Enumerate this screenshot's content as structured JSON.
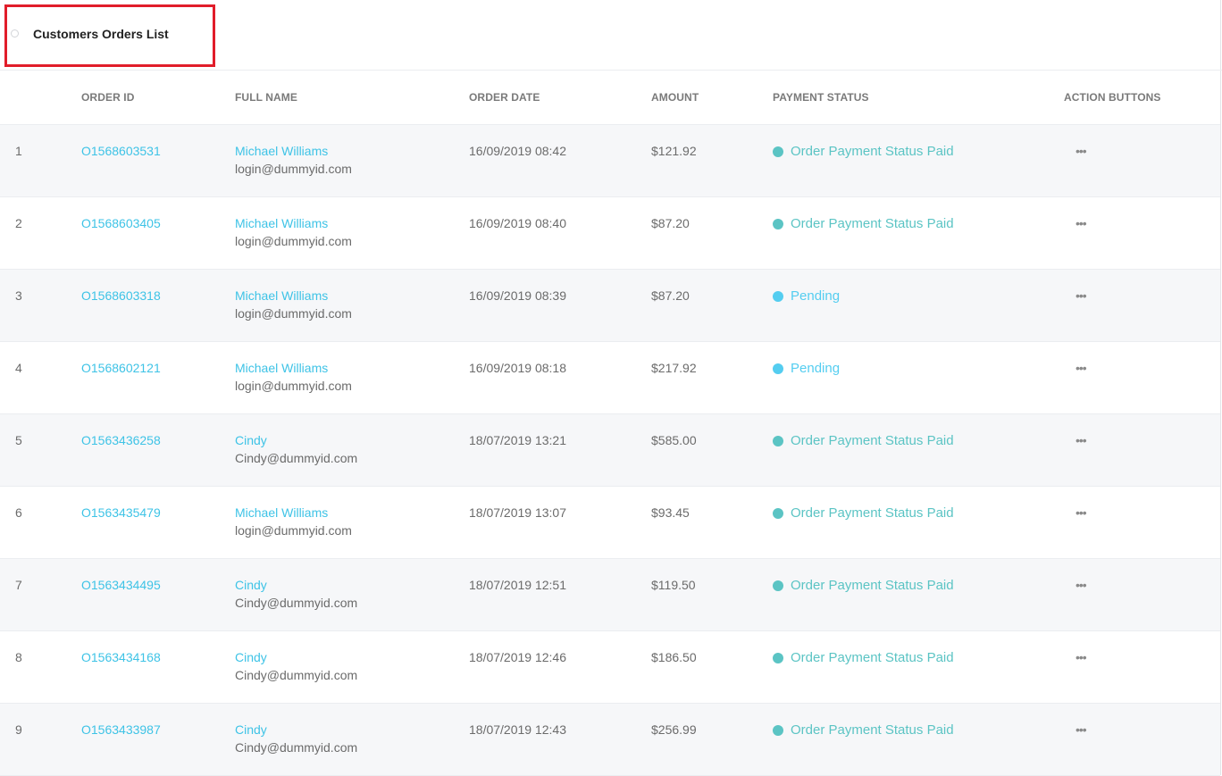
{
  "header": {
    "title": "Customers Orders List"
  },
  "colors": {
    "paid": "#5bc4c4",
    "pending": "#54cdf0",
    "link": "#3ec3e6",
    "highlight": "#e11d2a"
  },
  "table": {
    "columns": [
      "",
      "ORDER ID",
      "FULL NAME",
      "ORDER DATE",
      "AMOUNT",
      "PAYMENT STATUS",
      "ACTION BUTTONS"
    ],
    "rows": [
      {
        "num": "1",
        "order_id": "O1568603531",
        "name": "Michael Williams",
        "email": "login@dummyid.com",
        "date": "16/09/2019 08:42",
        "amount": "$121.92",
        "status": "Order Payment Status Paid",
        "status_type": "paid",
        "action_icon": "more-horizontal-icon"
      },
      {
        "num": "2",
        "order_id": "O1568603405",
        "name": "Michael Williams",
        "email": "login@dummyid.com",
        "date": "16/09/2019 08:40",
        "amount": "$87.20",
        "status": "Order Payment Status Paid",
        "status_type": "paid",
        "action_icon": "more-horizontal-icon"
      },
      {
        "num": "3",
        "order_id": "O1568603318",
        "name": "Michael Williams",
        "email": "login@dummyid.com",
        "date": "16/09/2019 08:39",
        "amount": "$87.20",
        "status": "Pending",
        "status_type": "pending",
        "action_icon": "more-horizontal-icon"
      },
      {
        "num": "4",
        "order_id": "O1568602121",
        "name": "Michael Williams",
        "email": "login@dummyid.com",
        "date": "16/09/2019 08:18",
        "amount": "$217.92",
        "status": "Pending",
        "status_type": "pending",
        "action_icon": "more-horizontal-icon"
      },
      {
        "num": "5",
        "order_id": "O1563436258",
        "name": "Cindy",
        "email": "Cindy@dummyid.com",
        "date": "18/07/2019 13:21",
        "amount": "$585.00",
        "status": "Order Payment Status Paid",
        "status_type": "paid",
        "action_icon": "more-horizontal-icon"
      },
      {
        "num": "6",
        "order_id": "O1563435479",
        "name": "Michael Williams",
        "email": "login@dummyid.com",
        "date": "18/07/2019 13:07",
        "amount": "$93.45",
        "status": "Order Payment Status Paid",
        "status_type": "paid",
        "action_icon": "more-horizontal-icon"
      },
      {
        "num": "7",
        "order_id": "O1563434495",
        "name": "Cindy",
        "email": "Cindy@dummyid.com",
        "date": "18/07/2019 12:51",
        "amount": "$119.50",
        "status": "Order Payment Status Paid",
        "status_type": "paid",
        "action_icon": "more-horizontal-icon"
      },
      {
        "num": "8",
        "order_id": "O1563434168",
        "name": "Cindy",
        "email": "Cindy@dummyid.com",
        "date": "18/07/2019 12:46",
        "amount": "$186.50",
        "status": "Order Payment Status Paid",
        "status_type": "paid",
        "action_icon": "more-horizontal-icon"
      },
      {
        "num": "9",
        "order_id": "O1563433987",
        "name": "Cindy",
        "email": "Cindy@dummyid.com",
        "date": "18/07/2019 12:43",
        "amount": "$256.99",
        "status": "Order Payment Status Paid",
        "status_type": "paid",
        "action_icon": "more-horizontal-icon"
      }
    ]
  }
}
